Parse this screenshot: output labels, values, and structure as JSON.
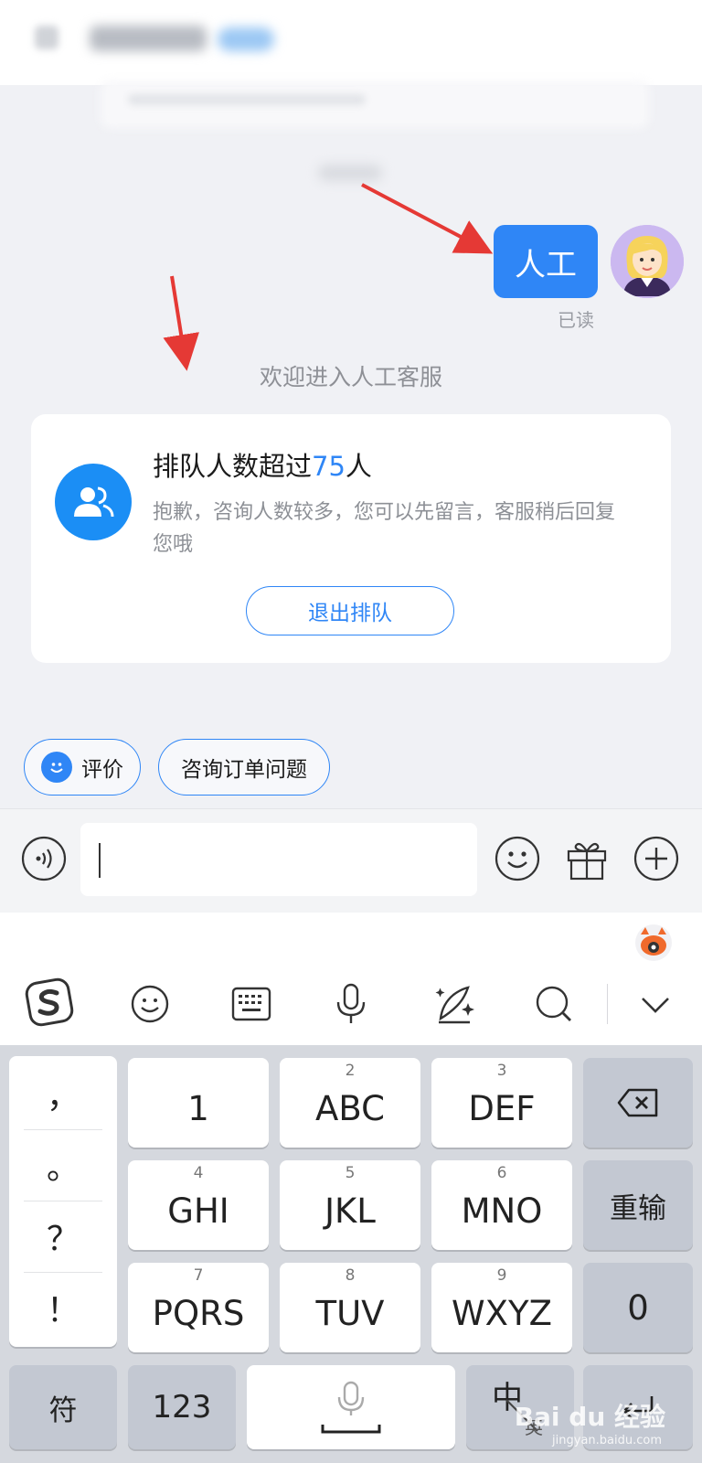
{
  "chat": {
    "user_message": "人工",
    "read_status": "已读",
    "system_message": "欢迎进入人工客服"
  },
  "queue_card": {
    "title_prefix": "排队人数超过",
    "count": "75",
    "title_suffix": "人",
    "body": "抱歉，咨询人数较多，您可以先留言，客服稍后回复您哦",
    "quit_button": "退出排队"
  },
  "quick_replies": {
    "rate": "评价",
    "order": "咨询订单问题"
  },
  "input_bar": {
    "icons": [
      "voice-icon",
      "emoji-icon",
      "gift-icon",
      "plus-icon"
    ]
  },
  "keyboard": {
    "toolbar": [
      "sogou-logo-icon",
      "emoji-icon",
      "keyboard-layout-icon",
      "microphone-icon",
      "handwriting-icon",
      "search-icon",
      "collapse-chevron-icon"
    ],
    "punctuation": [
      "，",
      "。",
      "？",
      "！"
    ],
    "keys": {
      "k1": {
        "main": "1",
        "sub": ""
      },
      "k2": {
        "main": "ABC",
        "sub": "2"
      },
      "k3": {
        "main": "DEF",
        "sub": "3"
      },
      "k4": {
        "main": "GHI",
        "sub": "4"
      },
      "k5": {
        "main": "JKL",
        "sub": "5"
      },
      "k6": {
        "main": "MNO",
        "sub": "6"
      },
      "k7": {
        "main": "PQRS",
        "sub": "7"
      },
      "k8": {
        "main": "TUV",
        "sub": "8"
      },
      "k9": {
        "main": "WXYZ",
        "sub": "9"
      }
    },
    "retype": "重输",
    "zero": "0",
    "symbols": "符",
    "numbers": "123",
    "lang_main": "中",
    "lang_alt": "英"
  },
  "watermark": {
    "brand": "Bai du 经验",
    "url": "jingyan.baidu.com"
  },
  "colors": {
    "accent": "#2f86f6",
    "annotation_arrow": "#e53935"
  }
}
